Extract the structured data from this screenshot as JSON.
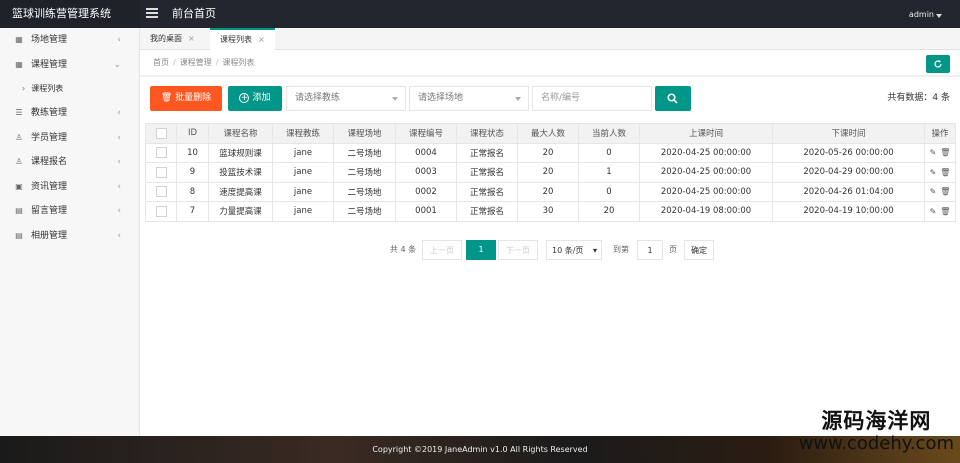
{
  "header": {
    "logo": "篮球训练营管理系统",
    "title": "前台首页",
    "user": "admin"
  },
  "sidebar": {
    "items": [
      {
        "label": "场地管理",
        "icon": "grid-icon",
        "glyph": "▦",
        "chevron": "‹"
      },
      {
        "label": "课程管理",
        "icon": "grid-icon",
        "glyph": "▦",
        "chevron": "⌄"
      },
      {
        "label": "教练管理",
        "icon": "sliders-icon",
        "glyph": "☰",
        "chevron": "‹"
      },
      {
        "label": "学员管理",
        "icon": "user-icon",
        "glyph": "♙",
        "chevron": "‹"
      },
      {
        "label": "课程报名",
        "icon": "user-icon",
        "glyph": "♙",
        "chevron": "‹"
      },
      {
        "label": "资讯管理",
        "icon": "news-icon",
        "glyph": "▣",
        "chevron": "‹"
      },
      {
        "label": "留言管理",
        "icon": "book-icon",
        "glyph": "▤",
        "chevron": "‹"
      },
      {
        "label": "相册管理",
        "icon": "book-icon",
        "glyph": "▤",
        "chevron": "‹"
      }
    ],
    "sub_item": {
      "arrow": "›",
      "label": "课程列表"
    }
  },
  "tabs": [
    {
      "label": "我的桌面",
      "close": "×"
    },
    {
      "label": "课程列表",
      "close": "×"
    }
  ],
  "breadcrumb": [
    "首页",
    "课程管理",
    "课程列表"
  ],
  "toolbar": {
    "delete_label": "批量删除",
    "add_label": "添加",
    "coach_placeholder": "请选择教练",
    "venue_placeholder": "请选择场地",
    "search_placeholder": "名称/编号",
    "total_label": "共有数据：4 条"
  },
  "table": {
    "headers": [
      "ID",
      "课程名称",
      "课程教练",
      "课程场地",
      "课程编号",
      "课程状态",
      "最大人数",
      "当前人数",
      "上课时间",
      "下课时间",
      "操作"
    ],
    "rows": [
      [
        "10",
        "篮球规则课",
        "jane",
        "二号场地",
        "0004",
        "正常报名",
        "20",
        "0",
        "2020-04-25 00:00:00",
        "2020-05-26 00:00:00"
      ],
      [
        "9",
        "投篮技术课",
        "jane",
        "二号场地",
        "0003",
        "正常报名",
        "20",
        "1",
        "2020-04-25 00:00:00",
        "2020-04-29 00:00:00"
      ],
      [
        "8",
        "速度提高课",
        "jane",
        "二号场地",
        "0002",
        "正常报名",
        "20",
        "0",
        "2020-04-25 00:00:00",
        "2020-04-26 01:04:00"
      ],
      [
        "7",
        "力量提高课",
        "jane",
        "二号场地",
        "0001",
        "正常报名",
        "30",
        "20",
        "2020-04-19 08:00:00",
        "2020-04-19 10:00:00"
      ]
    ],
    "ops": {
      "edit": "✎",
      "delete": "🗑"
    }
  },
  "pager": {
    "total": "共 4 条",
    "prev": "上一页",
    "current": "1",
    "next": "下一页",
    "page_size": "10 条/页",
    "goto_label": "到第",
    "goto_value": "1",
    "page_unit": "页",
    "confirm": "确定"
  },
  "footer": {
    "copyright": "Copyright ©2019 JaneAdmin v1.0 All Rights Reserved"
  },
  "watermark": {
    "line1": "源码海洋网",
    "line2": "www.codehy.com"
  },
  "colors": {
    "primary": "#009688",
    "danger": "#ff5722",
    "header": "#23262e"
  }
}
